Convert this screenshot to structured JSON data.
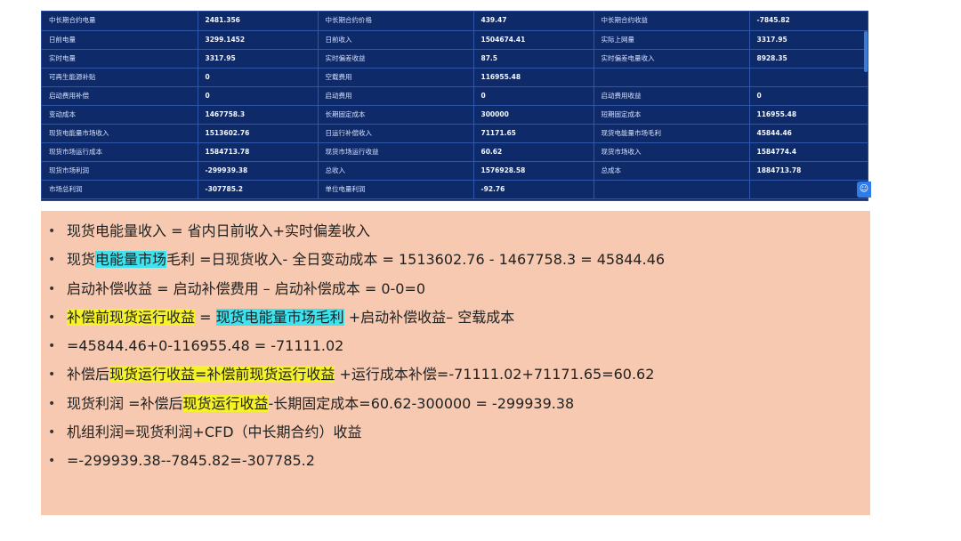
{
  "table": {
    "rows": [
      [
        {
          "label": "中长期合约电量",
          "value": "2481.356"
        },
        {
          "label": "中长期合约价格",
          "value": "439.47"
        },
        {
          "label": "中长期合约收益",
          "value": "-7845.82"
        }
      ],
      [
        {
          "label": "日前电量",
          "value": "3299.1452"
        },
        {
          "label": "日前收入",
          "value": "1504674.41"
        },
        {
          "label": "实际上网量",
          "value": "3317.95"
        }
      ],
      [
        {
          "label": "实时电量",
          "value": "3317.95"
        },
        {
          "label": "实时偏差收益",
          "value": "87.5"
        },
        {
          "label": "实时偏差电量收入",
          "value": "8928.35"
        }
      ],
      [
        {
          "label": "可再生能源补贴",
          "value": "0"
        },
        {
          "label": "空载费用",
          "value": "116955.48"
        },
        {
          "label": "",
          "value": ""
        }
      ],
      [
        {
          "label": "启动费用补偿",
          "value": "0"
        },
        {
          "label": "启动费用",
          "value": "0"
        },
        {
          "label": "启动费用收益",
          "value": "0"
        }
      ],
      [
        {
          "label": "变动成本",
          "value": "1467758.3"
        },
        {
          "label": "长期固定成本",
          "value": "300000"
        },
        {
          "label": "短期固定成本",
          "value": "116955.48"
        }
      ],
      [
        {
          "label": "现货电能量市场收入",
          "value": "1513602.76"
        },
        {
          "label": "日运行补偿收入",
          "value": "71171.65"
        },
        {
          "label": "现货电能量市场毛利",
          "value": "45844.46"
        }
      ],
      [
        {
          "label": "现货市场运行成本",
          "value": "1584713.78"
        },
        {
          "label": "现货市场运行收益",
          "value": "60.62"
        },
        {
          "label": "现货市场收入",
          "value": "1584774.4"
        }
      ],
      [
        {
          "label": "现货市场利润",
          "value": "-299939.38"
        },
        {
          "label": "总收入",
          "value": "1576928.58"
        },
        {
          "label": "总成本",
          "value": "1884713.78"
        }
      ],
      [
        {
          "label": "市场总利润",
          "value": "-307785.2"
        },
        {
          "label": "单位电量利润",
          "value": "-92.76"
        },
        {
          "label": "",
          "value": ""
        }
      ]
    ],
    "user_icon": "user-icon"
  },
  "notes": {
    "items": [
      [
        {
          "t": "现货电能量收入 = 省内日前收入+实时偏差收入"
        }
      ],
      [
        {
          "t": "现货"
        },
        {
          "t": "电能量市场",
          "hl": "cyan"
        },
        {
          "t": "毛利 =日现货收入- 全日变动成本 = 1513602.76 - 1467758.3 = 45844.46"
        }
      ],
      [
        {
          "t": "启动补偿收益 = 启动补偿费用 – 启动补偿成本 = 0-0=0"
        }
      ],
      [
        {
          "t": "补偿前现货运行收益",
          "hl": "yellow"
        },
        {
          "t": " = "
        },
        {
          "t": "现货电能量市场毛利",
          "hl": "cyan"
        },
        {
          "t": " +启动补偿收益– 空载成本"
        }
      ],
      [
        {
          "t": "=45844.46+0-116955.48 = -71111.02"
        }
      ],
      [
        {
          "t": "补偿后"
        },
        {
          "t": "现货运行收益=补偿前现货运行收益",
          "hl": "yellow"
        },
        {
          "t": " +运行成本补偿=-71111.02+71171.65=60.62"
        }
      ],
      [
        {
          "t": "现货利润 =补偿后"
        },
        {
          "t": "现货运行收益",
          "hl": "yellow"
        },
        {
          "t": "-长期固定成本=60.62-300000 = -299939.38"
        }
      ],
      [
        {
          "t": "机组利润=现货利润+CFD（中长期合约）收益"
        }
      ],
      [
        {
          "t": "=-299939.38--7845.82=-307785.2"
        }
      ]
    ],
    "colors": {
      "panel_background": "#f7c9b1",
      "highlight_cyan": "#3ee3f0",
      "highlight_yellow": "#f6f22a",
      "table_background": "#0f2a68"
    }
  }
}
